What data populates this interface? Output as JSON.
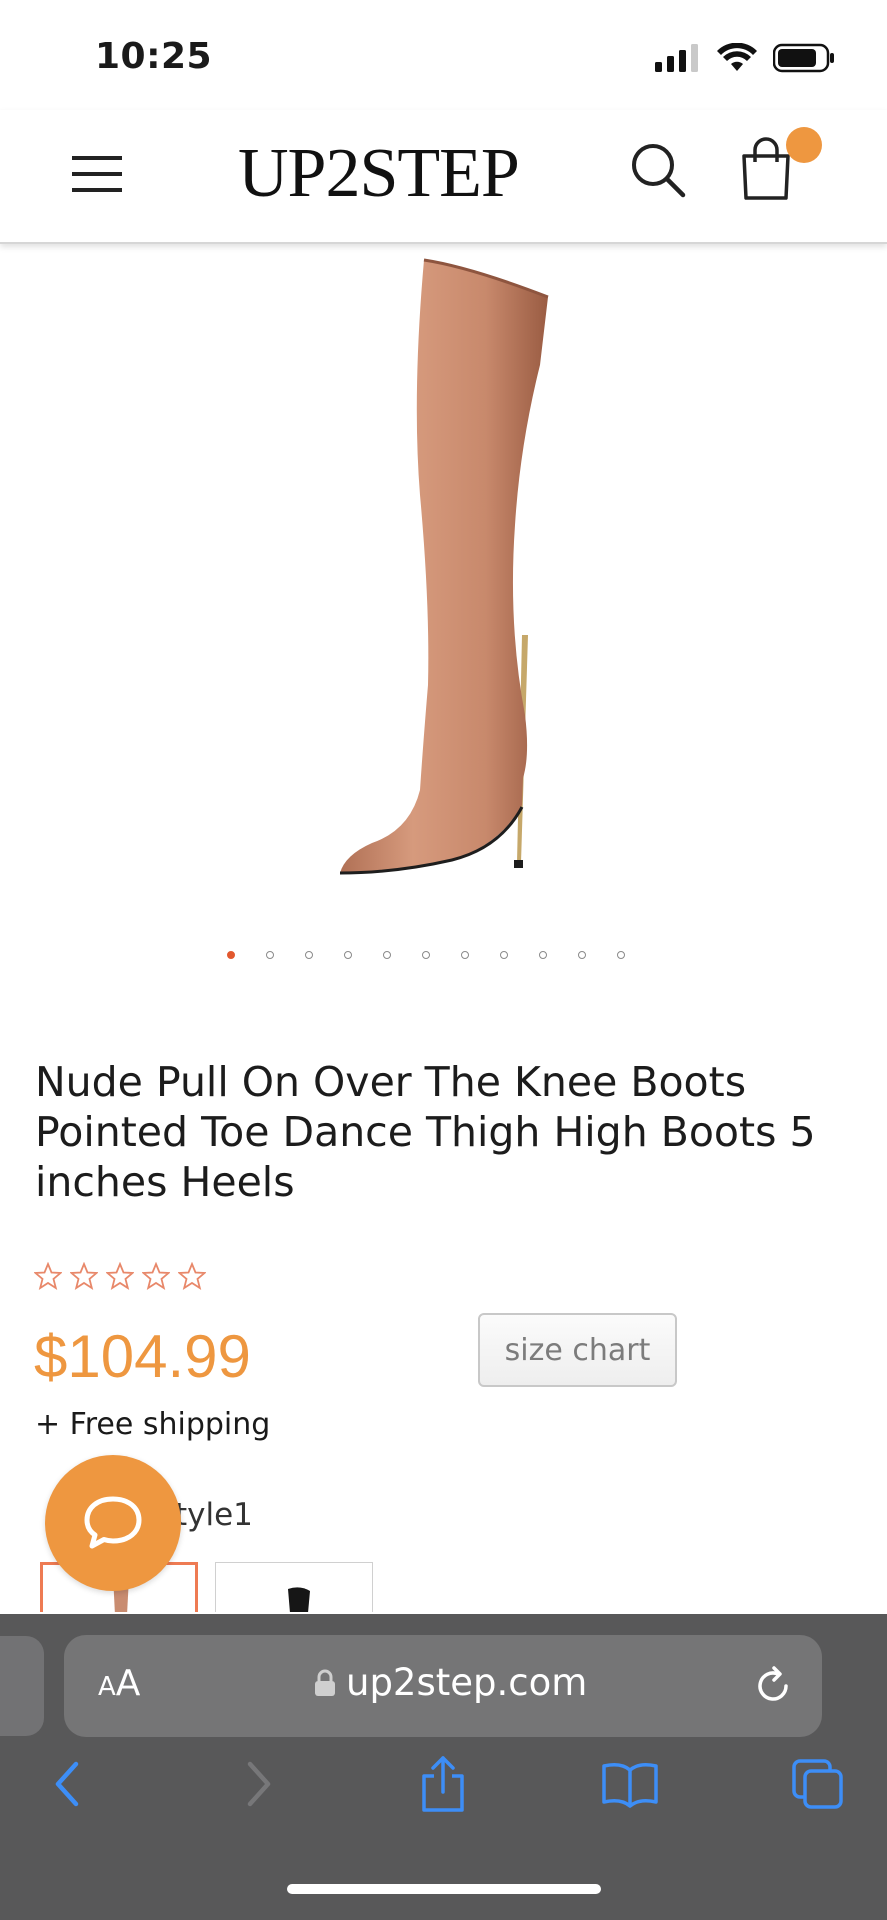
{
  "status_bar": {
    "time": "10:25",
    "icons": [
      "cellular-signal-icon",
      "wifi-icon",
      "battery-icon"
    ]
  },
  "header": {
    "logo": "UP2STEP",
    "icons": [
      "menu-icon",
      "search-icon",
      "shopping-bag-icon"
    ],
    "cart_indicator_color": "#ee9740"
  },
  "product": {
    "image_alt": "Nude over the knee stiletto boot",
    "carousel": {
      "total": 11,
      "active": 1,
      "active_color": "#e2582e"
    },
    "title": "Nude Pull On Over The Knee Boots Pointed Toe Dance Thigh High Boots 5 inches Heels",
    "rating": {
      "stars": 0,
      "max": 5,
      "star_color": "#e8886a"
    },
    "price": "$104.99",
    "price_color": "#ee9740",
    "shipping": "+ Free shipping",
    "size_chart_label": "size chart",
    "style_label": "tyle1",
    "swatches": [
      "nude",
      "black"
    ]
  },
  "chat": {
    "icon": "chat-bubble-icon",
    "color": "#ee9740"
  },
  "browser": {
    "text_size_small": "A",
    "text_size_large": "A",
    "url": "up2step.com",
    "icons": [
      "lock-icon",
      "reload-icon",
      "back-icon",
      "forward-icon",
      "share-icon",
      "bookmarks-icon",
      "tabs-icon"
    ],
    "accent_color": "#3d8ef7"
  }
}
